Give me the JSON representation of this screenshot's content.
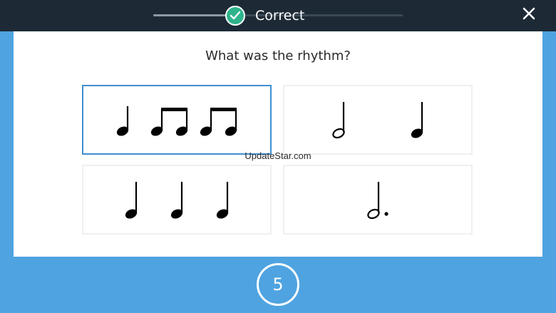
{
  "header": {
    "status_label": "Correct",
    "progress_fraction": 0.32,
    "close_icon": "close-icon",
    "check_icon": "check-icon",
    "success_color": "#2fb38d"
  },
  "question": {
    "text": "What was the rhythm?"
  },
  "options": [
    {
      "id": "quarter-eighths-eighths",
      "notes": "quarter, eighth-pair, eighth-pair",
      "selected": true
    },
    {
      "id": "half-quarter",
      "notes": "half, quarter",
      "selected": false
    },
    {
      "id": "three-quarters",
      "notes": "quarter, quarter, quarter",
      "selected": false
    },
    {
      "id": "dotted-half",
      "notes": "dotted half",
      "selected": false
    }
  ],
  "watermark": "UpdateStar.com",
  "footer": {
    "counter": "5"
  },
  "colors": {
    "background": "#4fa3e0",
    "topbar": "#1d2a36",
    "selected_border": "#3f8fd0"
  }
}
